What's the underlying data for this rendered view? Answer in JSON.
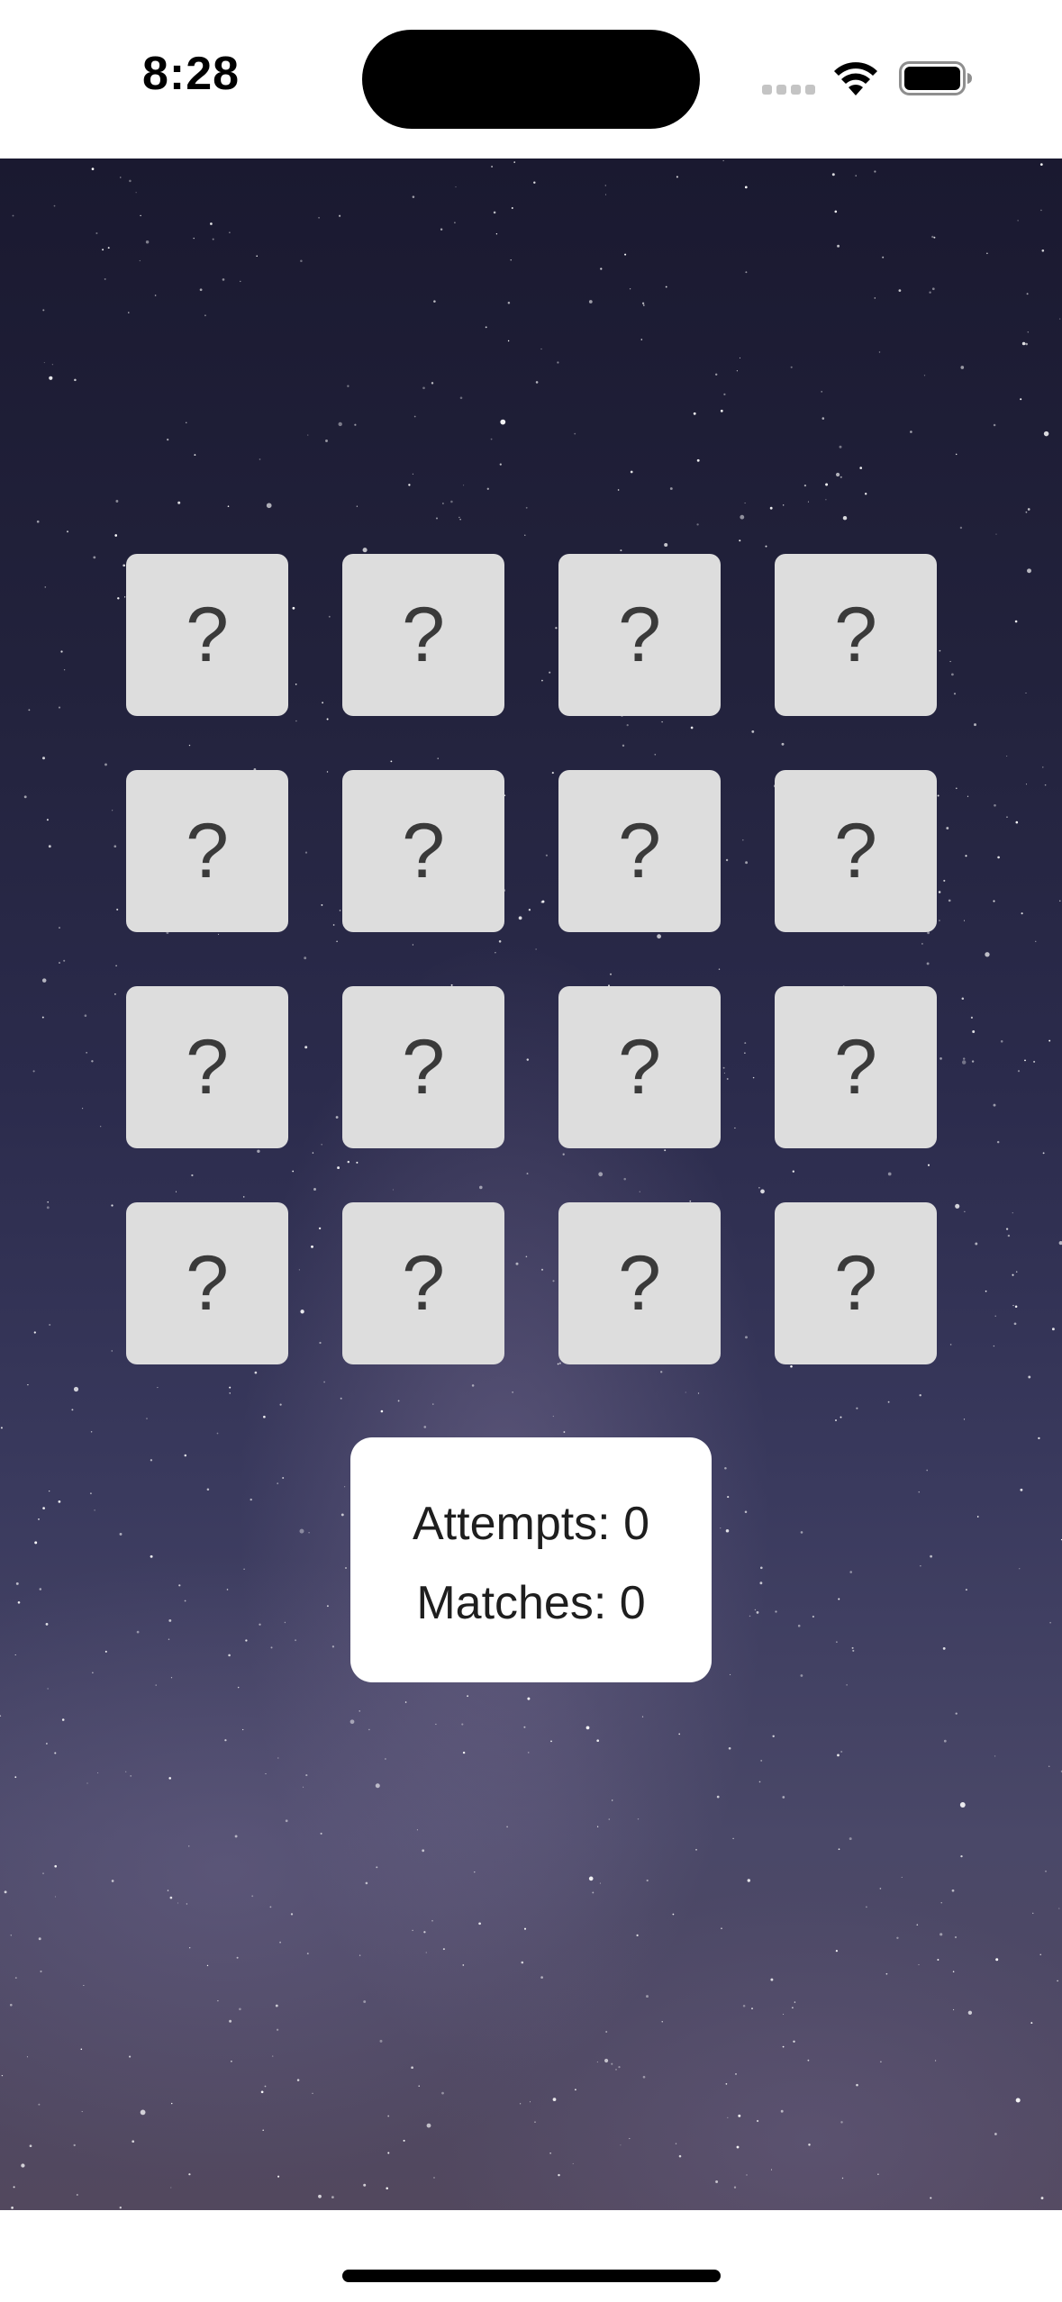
{
  "status_bar": {
    "time": "8:28",
    "icons": [
      "cellular-signal-icon",
      "wifi-icon",
      "battery-icon"
    ]
  },
  "game": {
    "background": "starry-night-sky",
    "cards": [
      {
        "face": "?"
      },
      {
        "face": "?"
      },
      {
        "face": "?"
      },
      {
        "face": "?"
      },
      {
        "face": "?"
      },
      {
        "face": "?"
      },
      {
        "face": "?"
      },
      {
        "face": "?"
      },
      {
        "face": "?"
      },
      {
        "face": "?"
      },
      {
        "face": "?"
      },
      {
        "face": "?"
      },
      {
        "face": "?"
      },
      {
        "face": "?"
      },
      {
        "face": "?"
      },
      {
        "face": "?"
      }
    ],
    "colors": {
      "card_back": "#dddddd",
      "card_glyph": "#3a3a3a",
      "panel": "#ffffff"
    }
  },
  "score": {
    "attempts": "Attempts: 0",
    "matches": "Matches: 0"
  }
}
